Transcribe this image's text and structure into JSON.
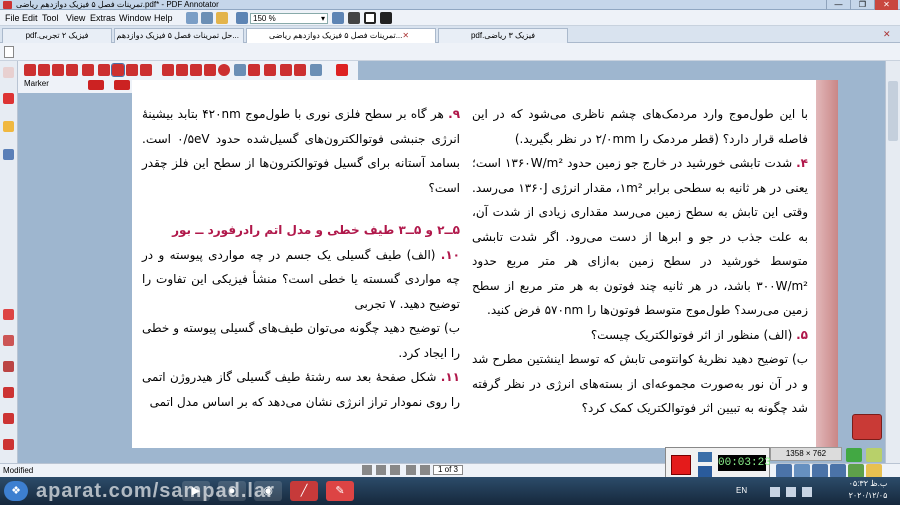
{
  "window": {
    "title": "تمرینات فصل ۵ فیزیک دوازدهم ریاضی.pdf* - PDF Annotator",
    "min": "—",
    "max": "❐",
    "close": "✕"
  },
  "menu": {
    "items": [
      "File",
      "Edit",
      "Tool",
      "View",
      "Extras",
      "Window",
      "Help"
    ]
  },
  "toolbar": {
    "zoom": "150 %"
  },
  "tabs": [
    {
      "label": "فیزیک ۲ تجربی.pdf"
    },
    {
      "label": "...حل تمرینات فصل ۵ فیزیک دوازدهم ری"
    },
    {
      "label": "...تمرینات فصل ۵ فیزیک دوازدهم ریاضی"
    },
    {
      "label": "فیزیک ۳ ریاضی.pdf"
    }
  ],
  "annot_toolbar": {
    "label": "Marker"
  },
  "doc": {
    "left_column": [
      {
        "num": "۹.",
        "text": " هر گاه بر سطح فلزی نوری با طول‌موج ۴۲۰nm بتابد بیشینهٔ انرژی جنبشی فوتوالکترون‌های گسیل‌شده حدود ۰/۵eV است. بسامد آستانه برای گسیل فوتوالکترون‌ها از سطح این فلز چقدر است؟"
      },
      {
        "heading": "۵ــ۲ و ۵ــ۳  طیف خطی و مدل اتم رادرفورد ــ بور"
      },
      {
        "num": "۱۰.",
        "text": " (الف) طیف گسیلی یک جسم در چه مواردی پیوسته و در چه مواردی گسسته یا خطی است؟ منشأ فیزیکی این تفاوت را توضیح دهید.  ۷ تجربی"
      },
      {
        "text": "ب) توضیح دهید چگونه می‌توان طیف‌های گسیلی پیوسته و خطی را ایجاد کرد."
      },
      {
        "num": "۱۱.",
        "text": " شکل صفحهٔ بعد سه رشتهٔ طیف گسیلی گاز هیدروژن اتمی را روی نمودار تراز انرژی نشان می‌دهد که بر اساس مدل اتمی"
      }
    ],
    "right_column": [
      {
        "text": "با این طول‌موج وارد مردمک‌های چشم ناظری می‌شود که در این فاصله قرار دارد؟ (قطر مردمک را ۲/۰mm در نظر بگیرید.)"
      },
      {
        "num": "۴.",
        "text": " شدت تابشی خورشید در خارج جو زمین حدود ۱۳۶۰W/m² است؛ یعنی در هر ثانیه به سطحی برابر ۱m²، مقدار انرژی ۱۳۶۰J می‌رسد. وقتی این تابش به سطح زمین می‌رسد مقداری زیادی از شدت آن، به علت جذب در جو و ابرها از دست می‌رود. اگر شدت تابشی متوسط خورشید در سطح زمین به‌ازای هر متر مربع حدود ۳۰۰W/m² باشد، در هر ثانیه چند فوتون به هر متر مربع از سطح زمین می‌رسد؟ طول‌موج متوسط فوتون‌ها را ۵۷۰nm فرض کنید."
      },
      {
        "num": "۵.",
        "text": " (الف) منظور از اثر فوتوالکتریک چیست؟"
      },
      {
        "text": "ب) توضیح دهید نظریهٔ کوانتومی تابش که توسط اینشتین مطرح شد و در آن نور به‌صورت مجموعه‌ای از بسته‌های انرژی در نظر گرفته شد چگونه به تبیین اثر فوتوالکتریک کمک کرد؟"
      }
    ]
  },
  "status": {
    "left": "Modified",
    "page": "1 of 3"
  },
  "recorder": {
    "time": "00:03:23",
    "resolution": "1358 × 762"
  },
  "taskbar": {
    "watermark": "aparat.com/sampad.lar",
    "lang": "EN",
    "time": "۰۵:۳۲ ب.ظ",
    "date": "۲۰۲۰/۱۲/۰۵"
  },
  "colors": {
    "accent": "#b0174a",
    "record": "#e41b1b"
  }
}
